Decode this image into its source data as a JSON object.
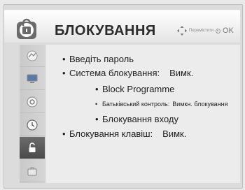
{
  "header": {
    "title": "БЛОКУВАННЯ",
    "hint_move": "Перемістити",
    "hint_ok": "OK"
  },
  "sidebar": {
    "items": [
      {
        "icon": "picture-icon"
      },
      {
        "icon": "monitor-icon"
      },
      {
        "icon": "speaker-icon"
      },
      {
        "icon": "clock-icon"
      },
      {
        "icon": "lock-icon",
        "active": true
      },
      {
        "icon": "briefcase-icon"
      }
    ]
  },
  "menu": {
    "password": "Введіть пароль",
    "lock_system_label": "Система блокування:",
    "lock_system_value": "Вимк.",
    "block_programme": "Block Programme",
    "parental_label": "Батьківський контроль:",
    "parental_value": "Вимкн. блокування",
    "input_block": "Блокування входу",
    "key_lock_label": "Блокування клавіш:",
    "key_lock_value": "Вимк."
  },
  "colors": {
    "active_sidebar": "#555555",
    "background": "#ececec"
  }
}
